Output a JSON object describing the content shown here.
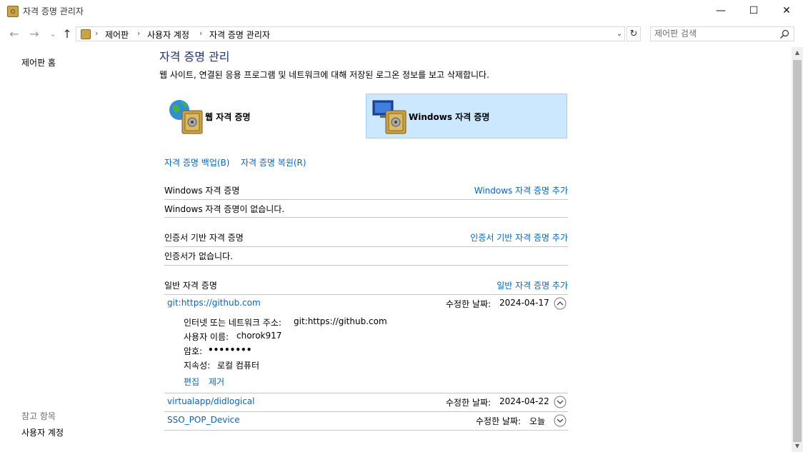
{
  "window": {
    "title": "자격 증명 관리자",
    "minimize": "—",
    "maximize": "☐",
    "close": "✕"
  },
  "nav": {
    "back": "←",
    "forward": "→",
    "recent": "⌄",
    "up": "↑",
    "breadcrumb": [
      "제어판",
      "사용자 계정",
      "자격 증명 관리자"
    ],
    "sep": "›",
    "dropdown": "⌄",
    "refresh": "↻"
  },
  "search": {
    "placeholder": "제어판 검색"
  },
  "left": {
    "home": "제어판 홈",
    "see_also": "참고 항목",
    "user_accounts": "사용자 계정"
  },
  "main": {
    "title": "자격 증명 관리",
    "description": "웹 사이트, 연결된 응용 프로그램 및 네트워크에 대해 저장된 로그온 정보를 보고 삭제합니다.",
    "web_credentials": "웹 자격 증명",
    "windows_credentials": "Windows 자격 증명",
    "backup": "자격 증명 백업(B)",
    "restore": "자격 증명 복원(R)"
  },
  "sections": {
    "windows": {
      "title": "Windows 자격 증명",
      "add": "Windows 자격 증명 추가",
      "empty": "Windows 자격 증명이 없습니다."
    },
    "certificate": {
      "title": "인증서 기반 자격 증명",
      "add": "인증서 기반 자격 증명 추가",
      "empty": "인증서가 없습니다."
    },
    "generic": {
      "title": "일반 자격 증명",
      "add": "일반 자격 증명 추가"
    }
  },
  "generic_items": [
    {
      "name": "git:https://github.com",
      "modified_label": "수정한 날짜:",
      "modified": "2024-04-17",
      "expanded": true,
      "details": {
        "address_label": "인터넷 또는 네트워크 주소:",
        "address": "git:https://github.com",
        "username_label": "사용자 이름:",
        "username": "chorok917",
        "password_label": "암호:",
        "password": "••••••••",
        "persistence_label": "지속성:",
        "persistence": "로컬 컴퓨터",
        "edit": "편집",
        "remove": "제거"
      }
    },
    {
      "name": "virtualapp/didlogical",
      "modified_label": "수정한 날짜:",
      "modified": "2024-04-22",
      "expanded": false
    },
    {
      "name": "SSO_POP_Device",
      "modified_label": "수정한 날짜:",
      "modified": "오늘",
      "expanded": false
    }
  ],
  "colors": {
    "link": "#0066cc",
    "title": "#1e3287",
    "selected_bg": "#cce8ff",
    "selected_border": "#99d1ff"
  }
}
